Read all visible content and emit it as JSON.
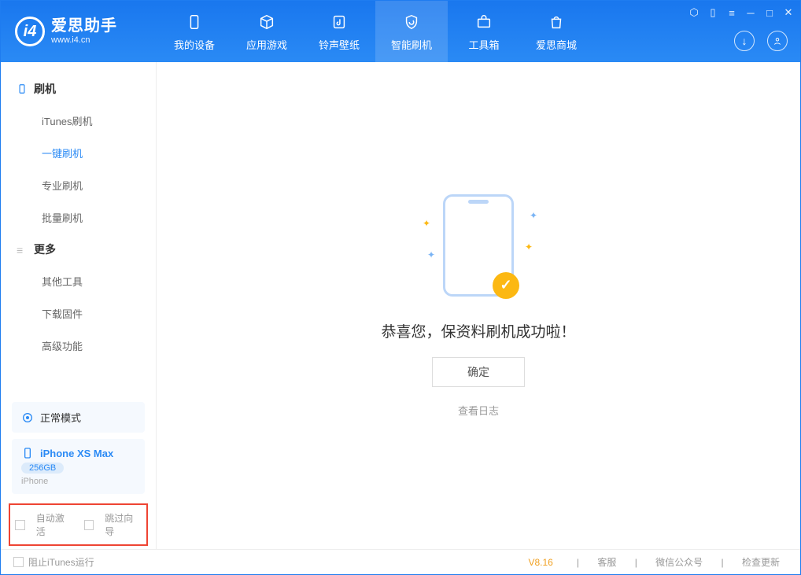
{
  "brand": {
    "name": "爱思助手",
    "site": "www.i4.cn"
  },
  "tabs": [
    {
      "label": "我的设备"
    },
    {
      "label": "应用游戏"
    },
    {
      "label": "铃声壁纸"
    },
    {
      "label": "智能刷机"
    },
    {
      "label": "工具箱"
    },
    {
      "label": "爱思商城"
    }
  ],
  "sidebar": {
    "section1": {
      "title": "刷机",
      "items": [
        "iTunes刷机",
        "一键刷机",
        "专业刷机",
        "批量刷机"
      ]
    },
    "section2": {
      "title": "更多",
      "items": [
        "其他工具",
        "下载固件",
        "高级功能"
      ]
    }
  },
  "mode": {
    "label": "正常模式"
  },
  "device": {
    "name": "iPhone XS Max",
    "capacity": "256GB",
    "type": "iPhone"
  },
  "options": {
    "auto_activate": "自动激活",
    "skip_guide": "跳过向导"
  },
  "main": {
    "message": "恭喜您，保资料刷机成功啦！",
    "ok": "确定",
    "view_log": "查看日志"
  },
  "footer": {
    "block_itunes": "阻止iTunes运行",
    "version": "V8.16",
    "links": [
      "客服",
      "微信公众号",
      "检查更新"
    ]
  }
}
